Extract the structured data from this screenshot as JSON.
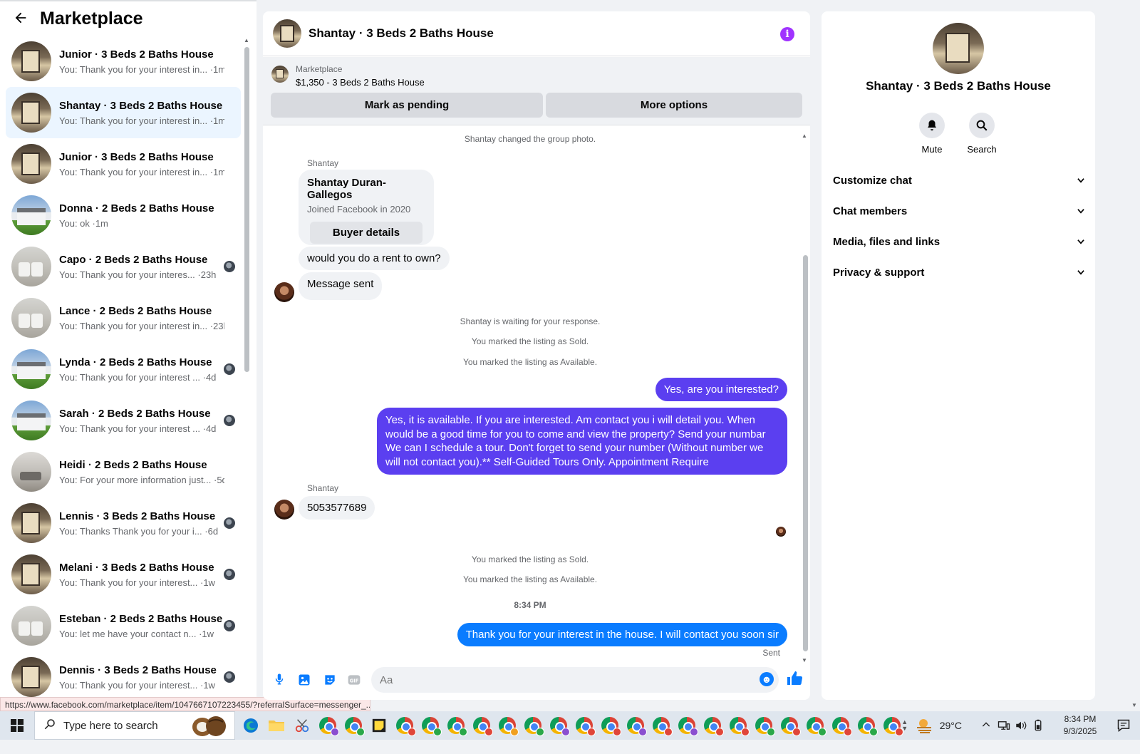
{
  "sidebar": {
    "title": "Marketplace",
    "conversations": [
      {
        "title": "Junior · 3 Beds 2 Baths House",
        "preview": "You: Thank you for your interest in... ·1m",
        "thumb": "interior",
        "mini": false
      },
      {
        "title": "Shantay · 3 Beds 2 Baths House",
        "preview": "You: Thank you for your interest in... ·1m",
        "thumb": "interior",
        "mini": false
      },
      {
        "title": "Junior · 3 Beds 2 Baths House",
        "preview": "You: Thank you for your interest in... ·1m",
        "thumb": "interior",
        "mini": false
      },
      {
        "title": "Donna · 2 Beds 2 Baths House",
        "preview": "You: ok ·1m",
        "thumb": "house",
        "mini": false
      },
      {
        "title": "Capo · 2 Beds 2 Baths House",
        "preview": "You: Thank you for your interes... ·23h",
        "thumb": "laundry",
        "mini": true
      },
      {
        "title": "Lance · 2 Beds 2 Baths House",
        "preview": "You: Thank you for your interest in... ·23h",
        "thumb": "laundry",
        "mini": false
      },
      {
        "title": "Lynda · 2 Beds 2 Baths House",
        "preview": "You: Thank you for your interest ... ·4d",
        "thumb": "house",
        "mini": true
      },
      {
        "title": "Sarah · 2 Beds 2 Baths House",
        "preview": "You: Thank you for your interest ... ·4d",
        "thumb": "house",
        "mini": true
      },
      {
        "title": "Heidi · 2 Beds 2 Baths House",
        "preview": "You: For your more information just... ·5d",
        "thumb": "living",
        "mini": false
      },
      {
        "title": "Lennis · 3 Beds 2 Baths House",
        "preview": "You: Thanks Thank you for your i... ·6d",
        "thumb": "interior",
        "mini": true
      },
      {
        "title": "Melani · 3 Beds 2 Baths House",
        "preview": "You: Thank you for your interest... ·1w",
        "thumb": "interior",
        "mini": true
      },
      {
        "title": "Esteban · 2 Beds 2 Baths House",
        "preview": "You: let me have your contact n... ·1w",
        "thumb": "laundry",
        "mini": true
      },
      {
        "title": "Dennis · 3 Beds 2 Baths House",
        "preview": "You: Thank you for your interest... ·1w",
        "thumb": "interior",
        "mini": true
      }
    ],
    "status_url": "https://www.facebook.com/marketplace/item/1047667107223455/?referralSurface=messenger_..."
  },
  "chat": {
    "title": "Shantay · 3 Beds 2 Baths House",
    "listing": {
      "label": "Marketplace",
      "price_title": "$1,350 - 3 Beds 2 Baths House",
      "btn_pending": "Mark as pending",
      "btn_more": "More options"
    },
    "sys_group_photo": "Shantay changed the group photo.",
    "sender1": "Shantay",
    "card": {
      "name": "Shantay Duran-Gallegos",
      "joined": "Joined Facebook in 2020",
      "button": "Buyer details"
    },
    "msg_rent": "would you do a rent to own?",
    "msg_sent_bubble": "Message sent",
    "sys_waiting": "Shantay is waiting for your response.",
    "sys_sold1": "You marked the listing as Sold.",
    "sys_avail1": "You marked the listing as Available.",
    "out_interested": "Yes, are you interested?",
    "out_long": "Yes, it is available. If you are interested.  Am contact you i will detail you.  When would be a good time for you to come and view the property? Send your numbar We can I schedule a tour.  Don't forget to send your number (Without number we will not contact you).** Self-Guided Tours Only. Appointment Require",
    "sender2": "Shantay",
    "msg_phone": "5053577689",
    "sys_sold2": "You marked the listing as Sold.",
    "sys_avail2": "You marked the listing as Available.",
    "time": "8:34 PM",
    "out_thanks": "Thank you for your interest in the house. I will contact you soon sir",
    "sent_status": "Sent",
    "input_placeholder": "Aa"
  },
  "info_panel": {
    "name": "Shantay · 3 Beds 2 Baths House",
    "mute_label": "Mute",
    "search_label": "Search",
    "sections": [
      "Customize chat",
      "Chat members",
      "Media, files and links",
      "Privacy & support"
    ]
  },
  "taskbar": {
    "search_placeholder": "Type here to search",
    "temperature": "29°C",
    "time": "8:34 PM",
    "date": "9/3/2025",
    "chrome_profile_colors": [
      "#e0463a",
      "#2aa84a",
      "#2aa84a",
      "#e0463a",
      "#f0a020",
      "#2aa84a",
      "#8a4fd0",
      "#e0463a",
      "#e0463a",
      "#8a4fd0",
      "#e0463a",
      "#8a4fd0",
      "#e0463a",
      "#e0463a",
      "#2aa84a",
      "#e0463a",
      "#2aa84a",
      "#e0463a",
      "#2aa84a",
      "#e0463a"
    ]
  }
}
